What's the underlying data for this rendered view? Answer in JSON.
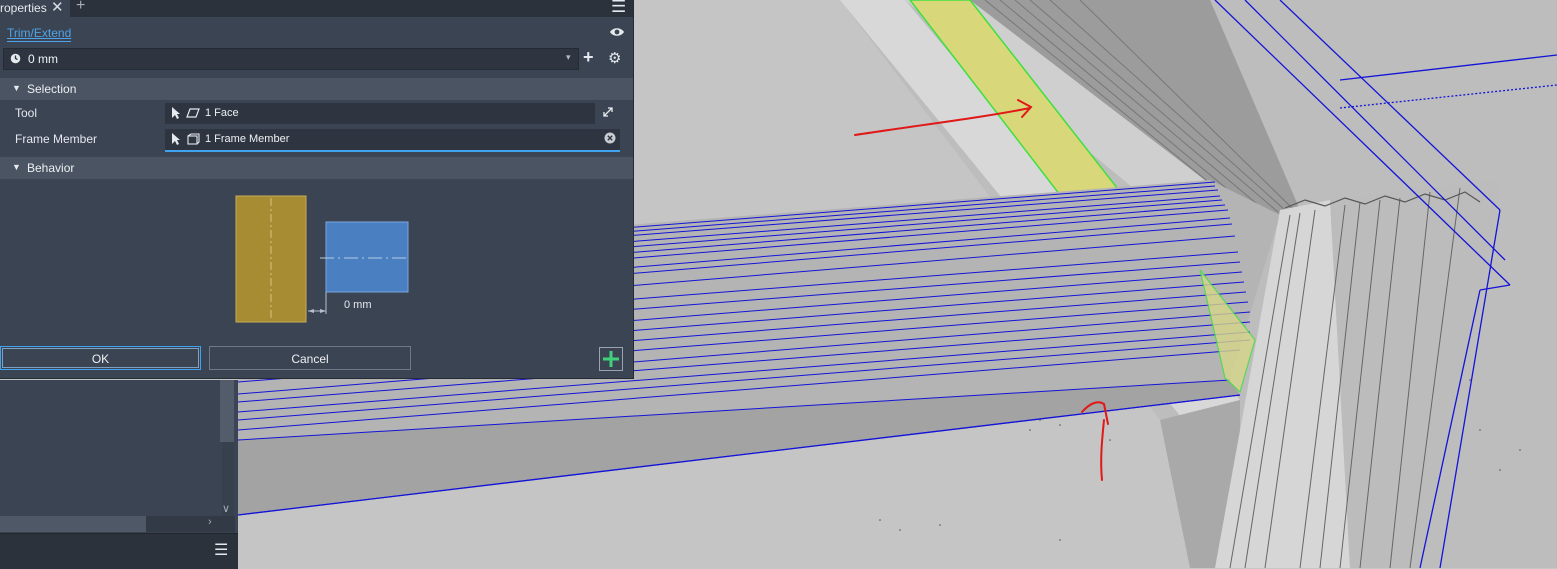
{
  "panel": {
    "tab_label": "roperties",
    "tab_close_glyph": "✕",
    "tab_add_glyph": "+",
    "menu_icon": "hamburger-menu-icon",
    "command_title": "Trim/Extend",
    "visibility_icon": "eye-icon",
    "preset": {
      "icon": "clock-icon",
      "value": "0 mm",
      "caret": "▾",
      "add_glyph": "+",
      "settings_glyph": "⚙"
    },
    "sections": {
      "selection": {
        "label": "Selection",
        "toggle": "▼"
      },
      "behavior": {
        "label": "Behavior",
        "toggle": "▼"
      }
    },
    "tool": {
      "label": "Tool",
      "value": "1 Face",
      "icon": "face-icon",
      "action_icon": "flip-icon"
    },
    "frame_member": {
      "label": "Frame Member",
      "value": "1 Frame Member",
      "icon": "frame-member-icon",
      "action_icon": "clear-icon"
    },
    "behavior_diagram": {
      "offset_label": "0 mm"
    },
    "buttons": {
      "ok": "OK",
      "cancel": "Cancel",
      "apply_icon": "plus-icon"
    }
  },
  "browser": {
    "scroll_down_glyph": "∨",
    "scroll_right_glyph": "›",
    "menu_glyph": "☰"
  },
  "colors": {
    "panel_bg": "#3b4453",
    "accent": "#3fa3ee",
    "tool_face": "#a88c34",
    "frame_member": "#4a7fc1",
    "selected_face": "#d8d87a",
    "wire_edges": "#1414d8",
    "markup": "#e01818"
  }
}
